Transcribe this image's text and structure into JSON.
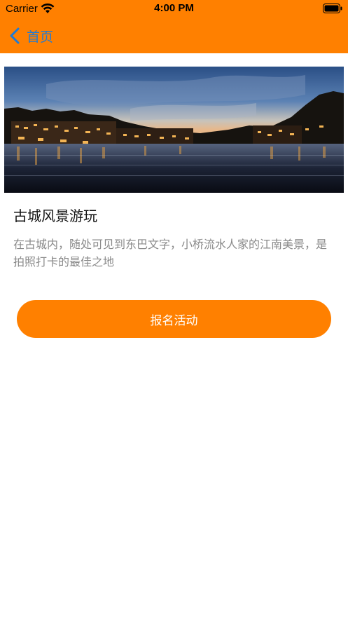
{
  "status_bar": {
    "carrier": "Carrier",
    "time": "4:00 PM",
    "wifi_icon": "wifi-icon",
    "battery_icon": "battery-icon"
  },
  "nav": {
    "back_label": "首页",
    "back_icon": "chevron-left-icon"
  },
  "activity": {
    "image": "night river scene of ancient town with lit wooden stilt houses",
    "title": "古城风景游玩",
    "description": "在古城内，随处可见到东巴文字，小桥流水人家的江南美景，是拍照打卡的最佳之地"
  },
  "actions": {
    "signup_label": "报名活动"
  },
  "colors": {
    "accent": "#ff8000",
    "link": "#1e7bd6",
    "description_text": "#8a8a8a"
  }
}
